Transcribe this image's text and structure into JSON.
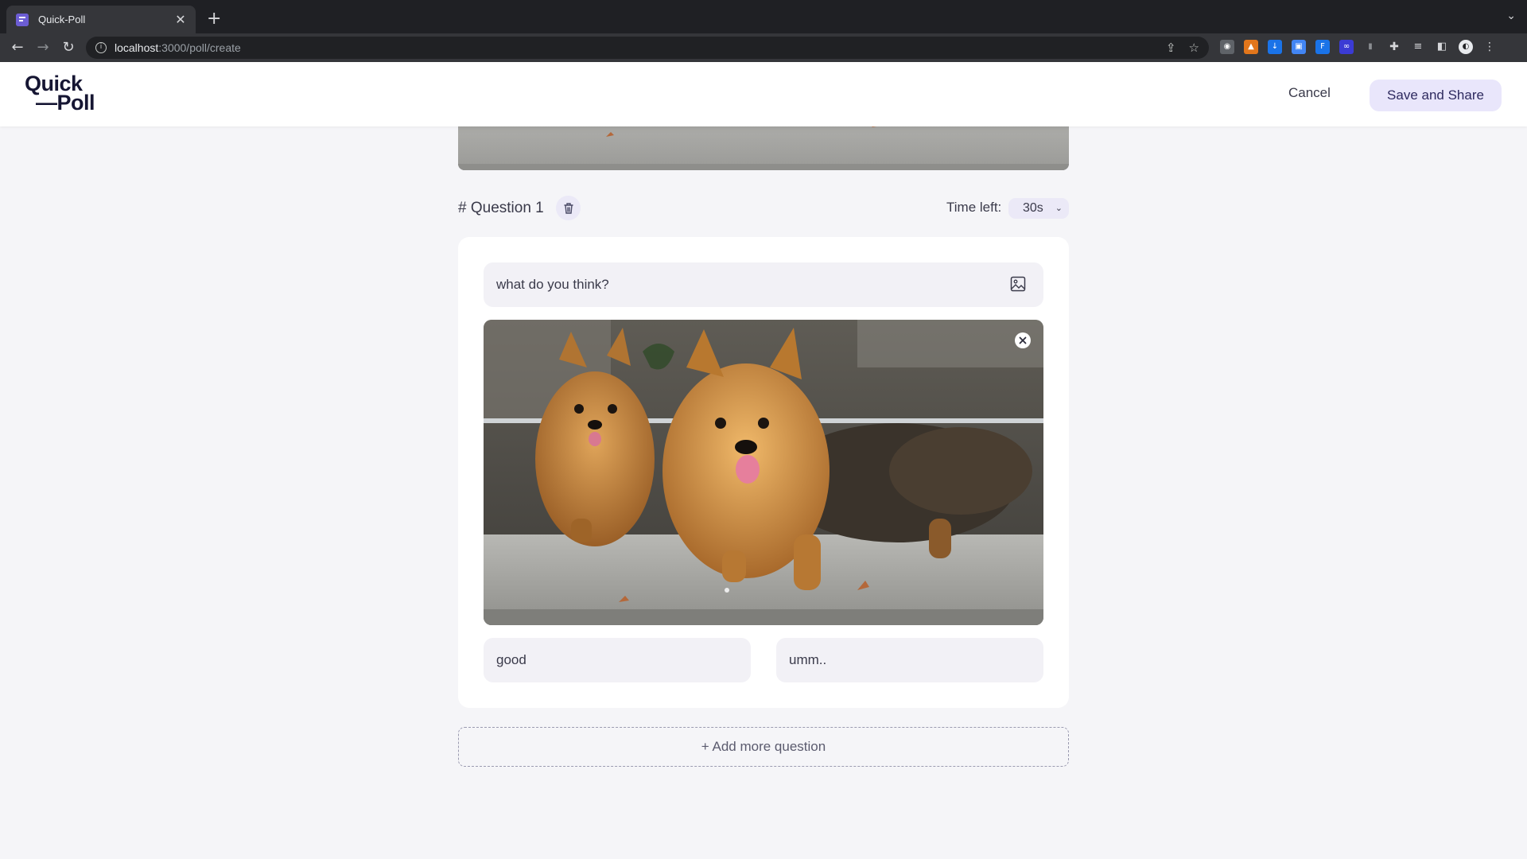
{
  "browser": {
    "tab_title": "Quick-Poll",
    "tab_favicon_text": "Quick Poll",
    "url_host": "localhost",
    "url_path": ":3000/poll/create"
  },
  "header": {
    "logo_line1": "Quick",
    "logo_line2": "—Poll",
    "cancel_label": "Cancel",
    "save_label": "Save and Share"
  },
  "question": {
    "title": "# Question 1",
    "time_label": "Time left:",
    "time_value": "30s",
    "text": "what do you think?",
    "image_subject": "two Yorkshire terrier dogs",
    "options": [
      "good",
      "umm.."
    ]
  },
  "add_question_label": "+ Add more question",
  "colors": {
    "accent_bg": "#e9e6fb",
    "accent_text": "#2e2a5f",
    "page_bg": "#f5f5f8"
  }
}
